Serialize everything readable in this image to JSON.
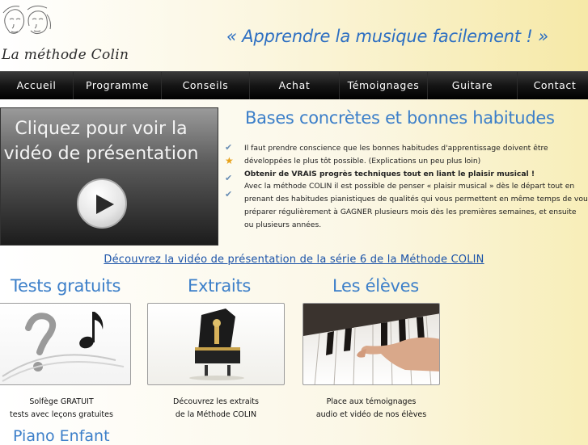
{
  "header": {
    "logo_text": "La méthode Colin",
    "slogan": "« Apprendre la musique facilement ! »"
  },
  "nav": {
    "items": [
      {
        "label": "Accueil"
      },
      {
        "label": "Programme"
      },
      {
        "label": "Conseils"
      },
      {
        "label": "Achat"
      },
      {
        "label": "Témoignages"
      },
      {
        "label": "Guitare"
      },
      {
        "label": "Contact"
      }
    ]
  },
  "video": {
    "title_line1": "Cliquez pour voir la",
    "title_line2": "vidéo de présentation"
  },
  "intro": {
    "title": "Bases concrètes et bonnes habitudes",
    "lines": [
      "Il faut prendre conscience que les bonnes habitudes d'apprentissage doivent être",
      "développées le plus tôt possible. (Explications un peu plus loin)",
      "Obtenir de VRAIS progrès techniques tout en liant le plaisir musical !",
      "Avec la méthode COLIN il est possible de penser  « plaisir musical » dès le départ tout en",
      "prenant des habitudes pianistiques  de qualités qui vous permettent en même temps de vous",
      "préparer régulièrement à GAGNER plusieurs mois dès les premières semaines, et ensuite",
      "ou plusieurs années."
    ]
  },
  "promo_link": "Découvrez la vidéo de présentation de la série 6 de la Méthode COLIN",
  "sections": [
    {
      "title": "Tests gratuits",
      "caption1": "Solfège GRATUIT",
      "caption2": "tests avec leçons gratuites"
    },
    {
      "title": "Extraits",
      "caption1": "Découvrez les extraits",
      "caption2": "de la Méthode COLIN"
    },
    {
      "title": "Les élèves",
      "caption1": "Place aux témoignages",
      "caption2": "audio et vidéo de nos élèves"
    }
  ],
  "bottom_title": "Piano Enfant",
  "colors": {
    "accent": "#3c7fc9",
    "link": "#1a52a8",
    "nav_bg": "#111111"
  },
  "icons": [
    "checkmark-icon",
    "star-icon",
    "play-icon",
    "question-mark-icon",
    "music-note-icon",
    "music-box-piano-icon",
    "piano-keys-hand-icon"
  ]
}
